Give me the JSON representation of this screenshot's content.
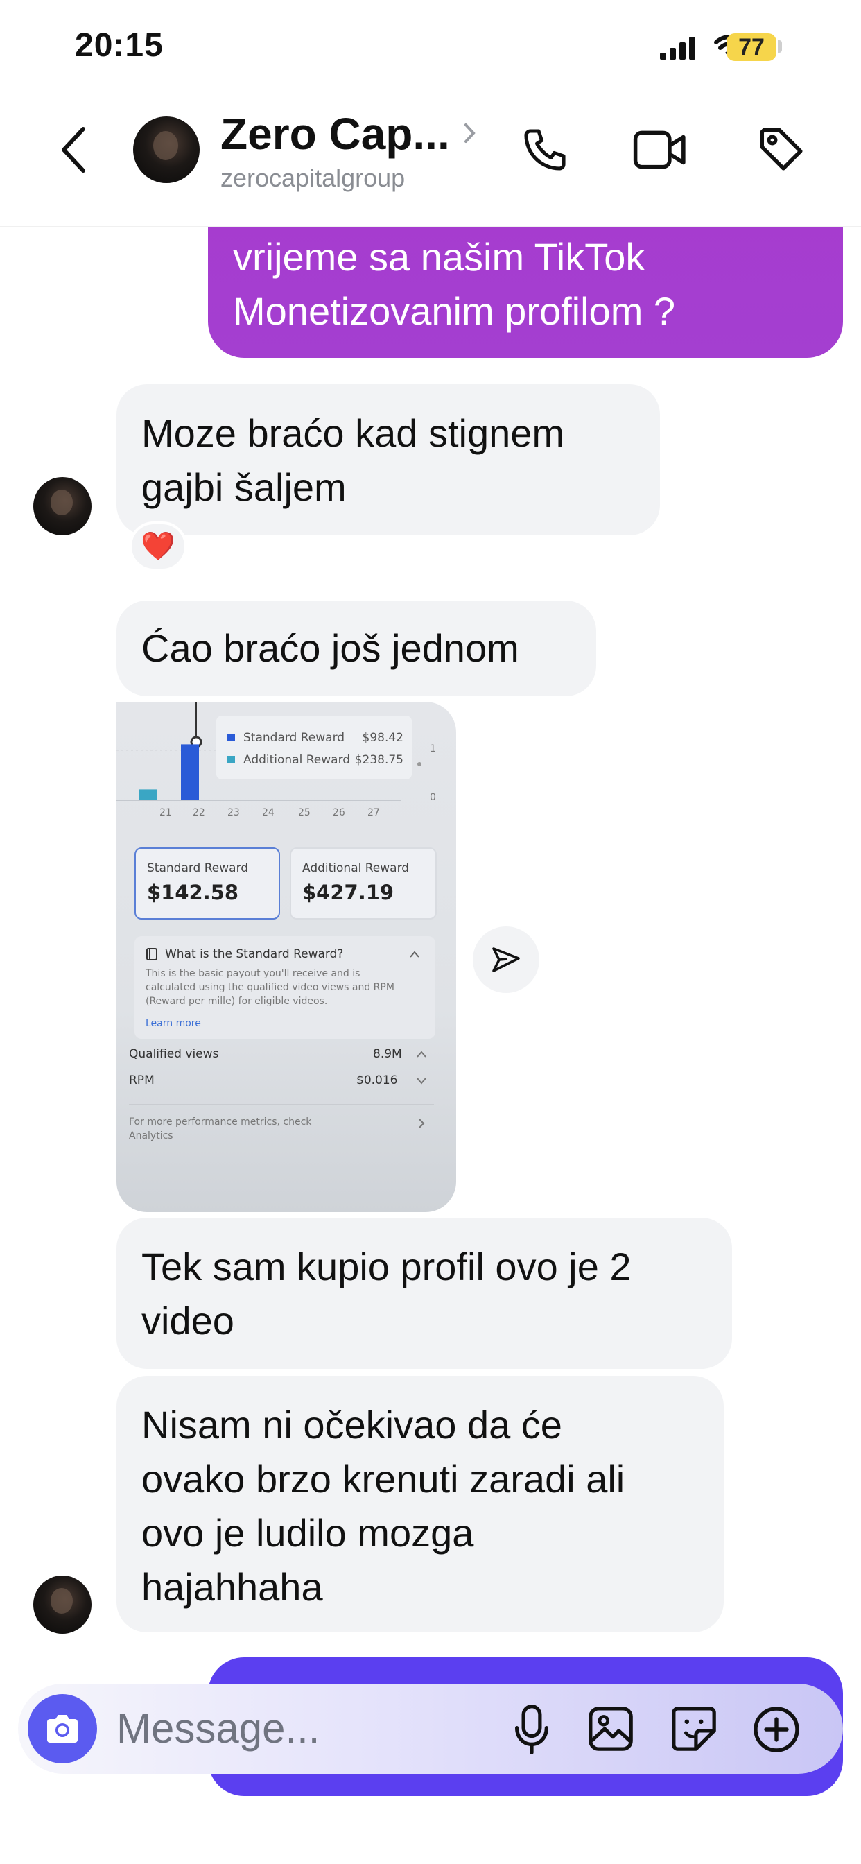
{
  "status_bar": {
    "time": "20:15",
    "battery": "77"
  },
  "header": {
    "name": "Zero Cap...",
    "handle": "zerocapitalgroup"
  },
  "messages": [
    {
      "dir": "out",
      "text": "vrijeme sa našim TikTok\nMonetizovanim profilom ?"
    },
    {
      "dir": "in",
      "text": "Moze braćo kad stignem\ngajbi šaljem",
      "reaction": "❤️"
    },
    {
      "dir": "in",
      "text": "Ćao braćo još jednom"
    },
    {
      "dir": "in",
      "text": "Tek sam kupio profil ovo je 2\nvideo"
    },
    {
      "dir": "in",
      "text": "Nisam ni očekivao da će\novako brzo krenuti zaradi ali\novo je ludilo mozga\nhajahhaha"
    }
  ],
  "shared_image": {
    "legend": [
      {
        "label": "Standard Reward",
        "value": "$98.42"
      },
      {
        "label": "Additional Reward",
        "value": "$238.75"
      }
    ],
    "x_ticks": [
      "21",
      "22",
      "23",
      "24",
      "25",
      "26",
      "27"
    ],
    "y_ticks": [
      "1",
      "0"
    ],
    "bar_levels": [
      0.12,
      0.62,
      0,
      0,
      0,
      0,
      0
    ],
    "cards": [
      {
        "label": "Standard Reward",
        "value": "$142.58"
      },
      {
        "label": "Additional Reward",
        "value": "$427.19"
      }
    ],
    "info_title": "What is the Standard Reward?",
    "info_body": "This is the basic payout you'll receive and is calculated using the qualified video views and RPM (Reward per mille) for eligible videos.",
    "learn_more": "Learn more",
    "metrics": [
      {
        "label": "Qualified views",
        "value": "8.9M"
      },
      {
        "label": "RPM",
        "value": "$0.016"
      }
    ],
    "footer": "For more performance metrics, check Analytics"
  },
  "composer": {
    "placeholder": "Message..."
  },
  "colors": {
    "outgoing_gradient_top": "#a63ccf",
    "outgoing_bottom": "#5b3ff0",
    "incoming_bubble": "#f2f3f5",
    "accent": "#5b5bf0",
    "battery": "#f6d54b"
  },
  "icons": [
    "back-icon",
    "chevron-right-icon",
    "phone-icon",
    "video-icon",
    "tag-icon",
    "send-icon",
    "camera-icon",
    "microphone-icon",
    "gallery-icon",
    "sticker-icon",
    "plus-icon"
  ]
}
